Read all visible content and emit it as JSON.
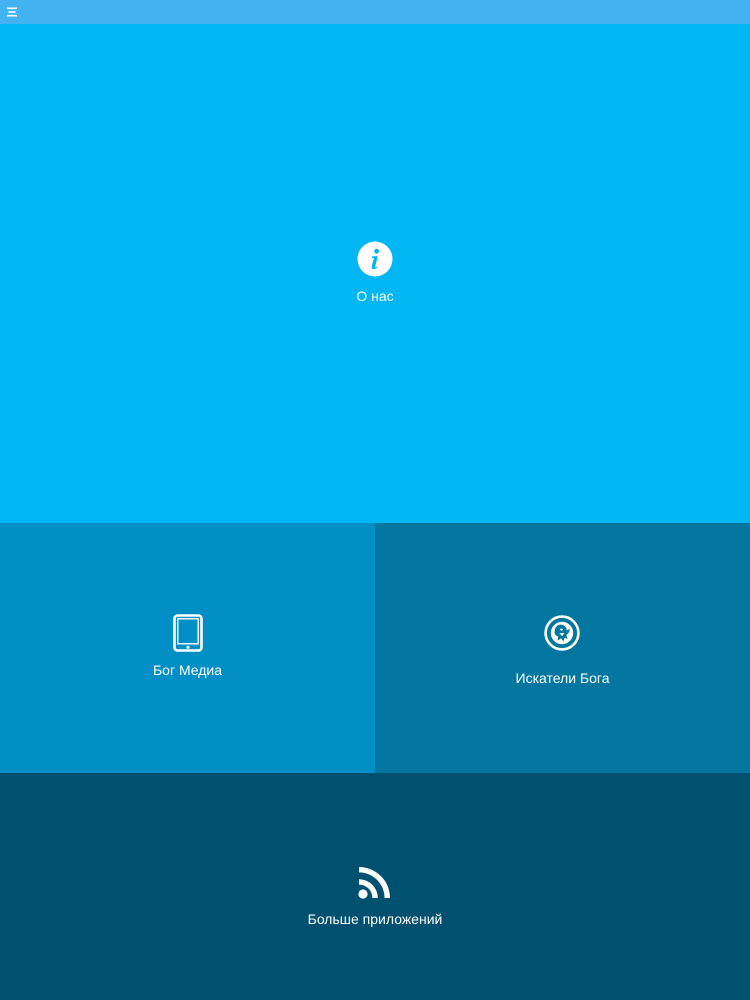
{
  "topbar": {
    "menu_icon": "menu-icon",
    "color": "#42b2f1"
  },
  "tiles": {
    "about": {
      "label": "О нас",
      "icon": "info-icon",
      "color": "#00b7f4"
    },
    "media": {
      "label": "Бог Медиа",
      "icon": "tablet-icon",
      "color": "#028fc6"
    },
    "seekers": {
      "label": "Искатели Бога",
      "icon": "seekers-emblem-icon",
      "color": "#03779f"
    },
    "more_apps": {
      "label": "Больше приложений",
      "icon": "rss-icon",
      "color": "#00506f"
    }
  }
}
